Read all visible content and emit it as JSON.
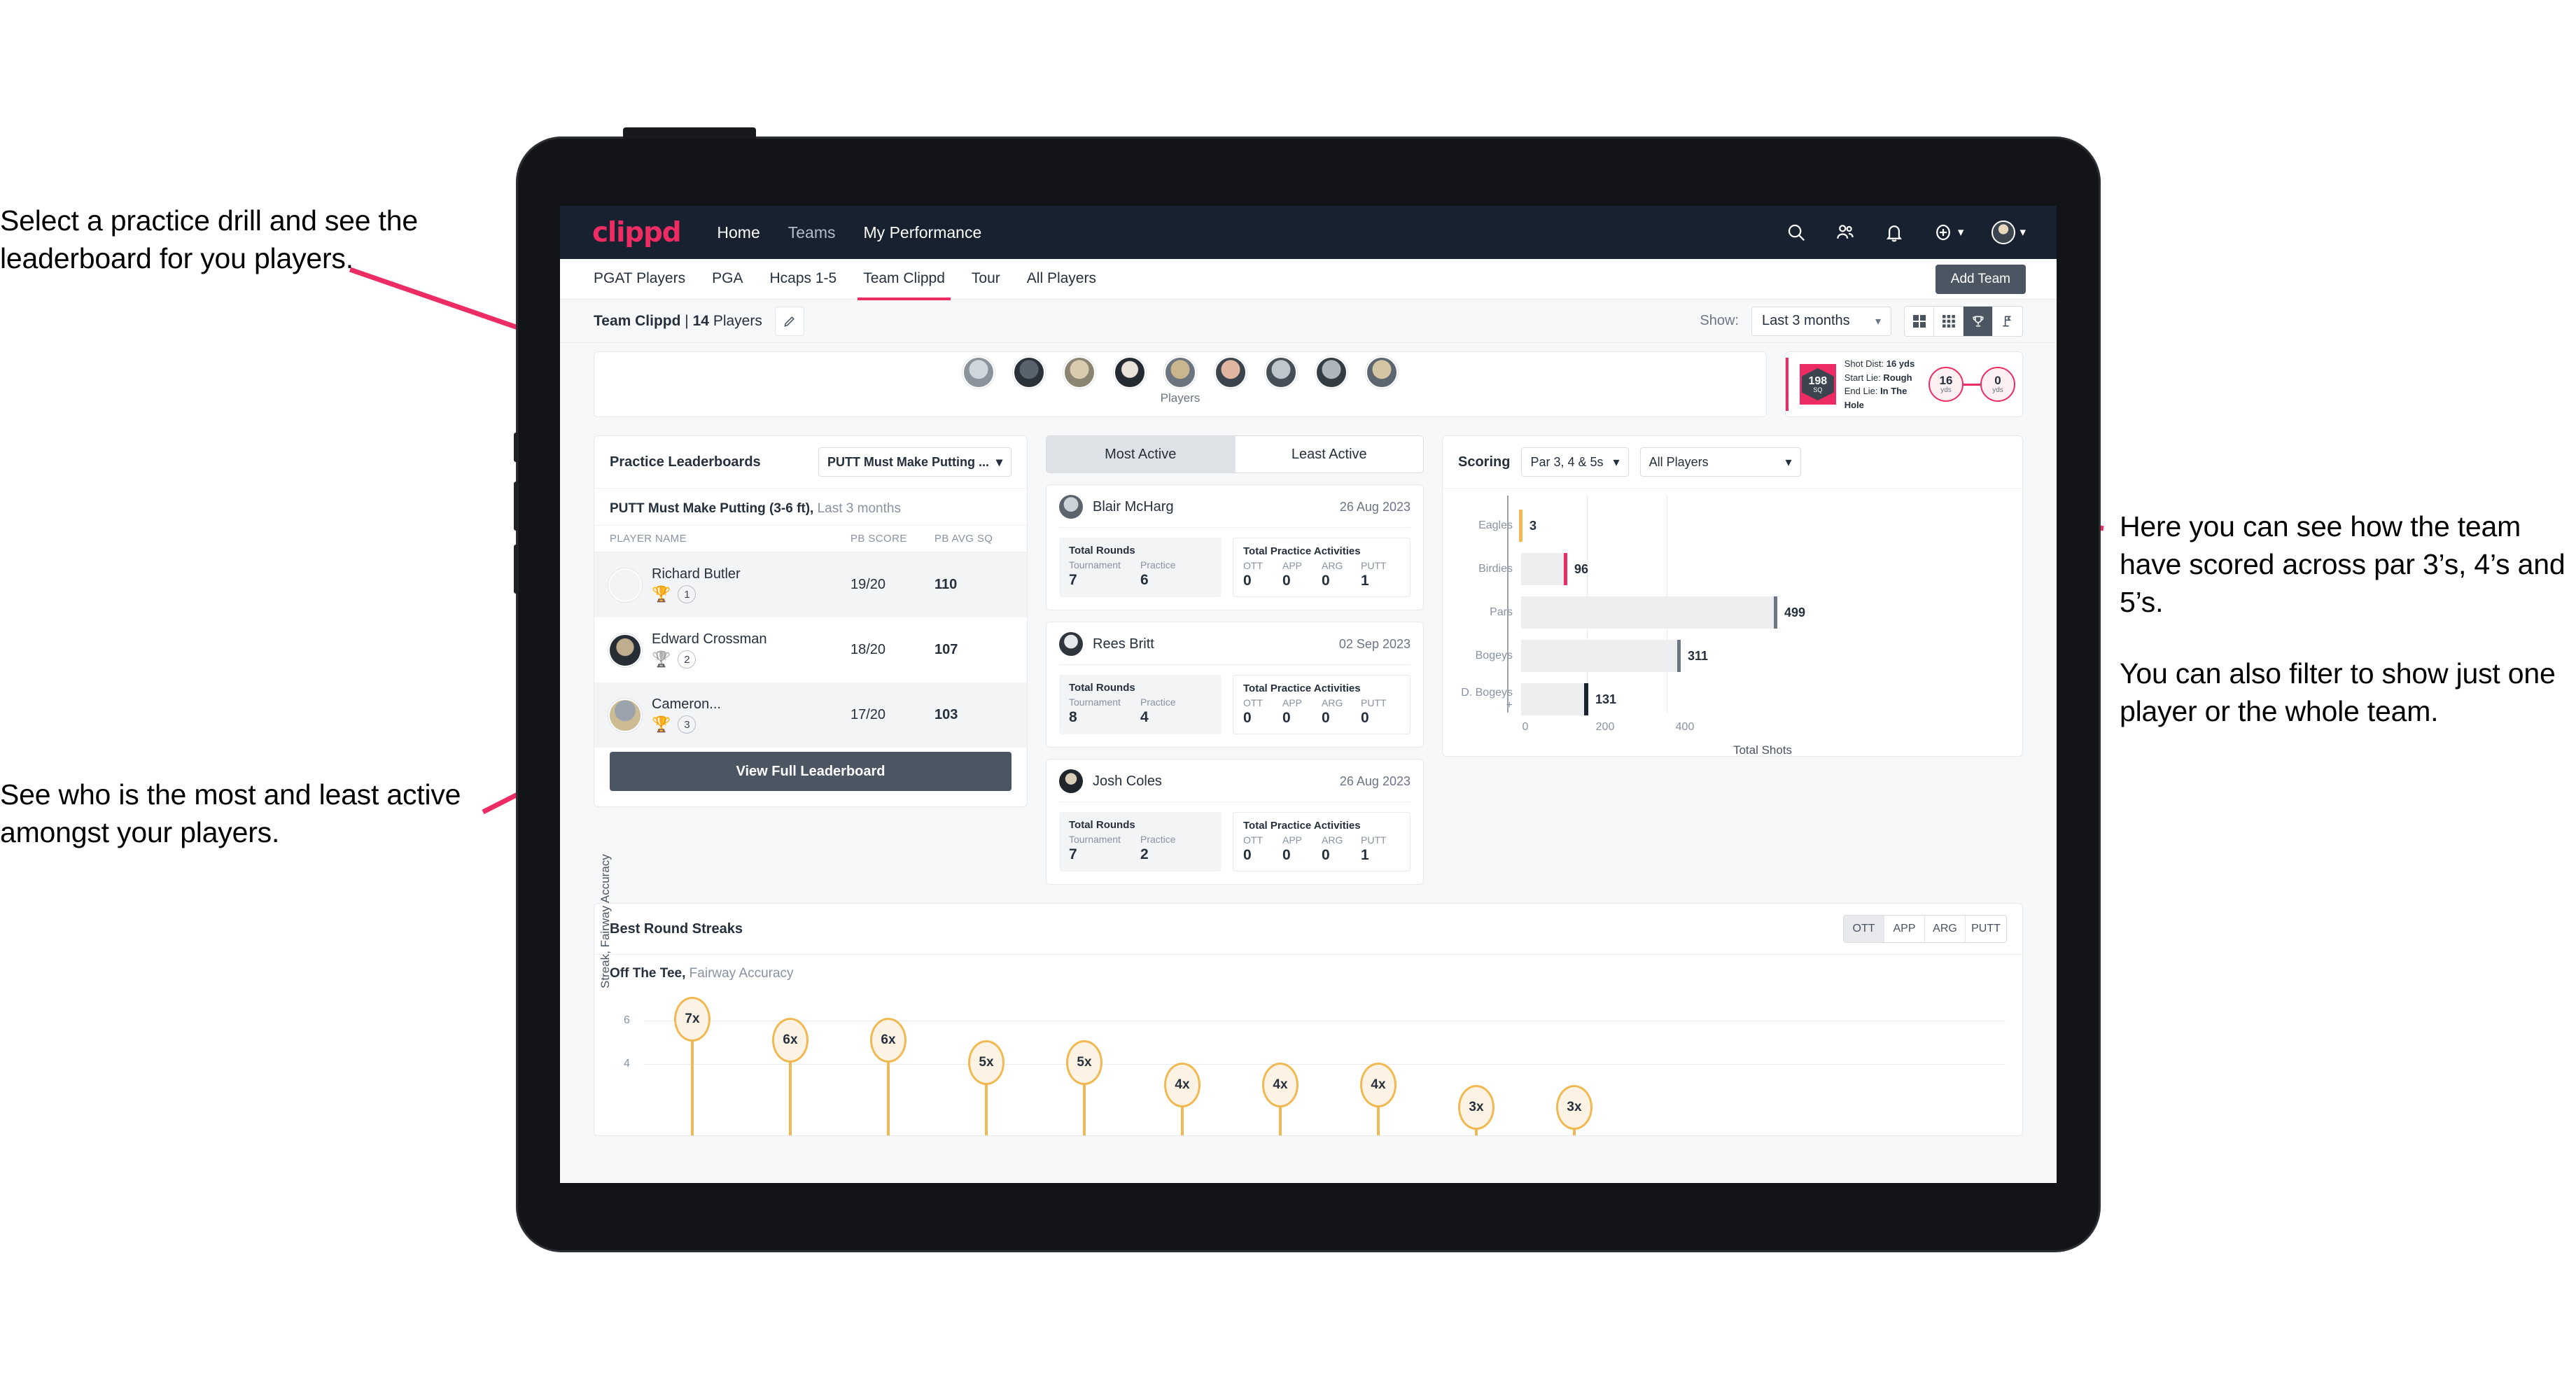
{
  "annotations": {
    "top_left": "Select a practice drill and see the leaderboard for you players.",
    "bottom_left": "See who is the most and least active amongst your players.",
    "right_1": "Here you can see how the team have scored across par 3’s, 4’s and 5’s.",
    "right_2": "You can also filter to show just one player or the whole team."
  },
  "topnav": {
    "brand": "clippd",
    "links": [
      {
        "label": "Home",
        "dim": false
      },
      {
        "label": "Teams",
        "dim": true
      },
      {
        "label": "My Performance",
        "dim": false
      }
    ],
    "icons": [
      "search-icon",
      "people-icon",
      "bell-icon",
      "plus-circle-icon",
      "avatar"
    ]
  },
  "tabs": {
    "items": [
      {
        "label": "PGAT Players",
        "active": false
      },
      {
        "label": "PGA",
        "active": false
      },
      {
        "label": "Hcaps 1-5",
        "active": false
      },
      {
        "label": "Team Clippd",
        "active": true
      },
      {
        "label": "Tour",
        "active": false
      },
      {
        "label": "All Players",
        "active": false
      }
    ],
    "add_team_label": "Add Team"
  },
  "subheader": {
    "team_name": "Team Clippd",
    "separator": "|",
    "player_count": "14",
    "players_word": "Players",
    "edit_icon": "pencil-icon",
    "show_label": "Show:",
    "range_value": "Last 3 months",
    "view_buttons": [
      "grid-large-icon",
      "grid-small-icon",
      "trophy-icon",
      "flag-icon"
    ]
  },
  "players_strip": {
    "caption": "Players",
    "avatar_count": 9
  },
  "shot_card": {
    "sq_value": "198",
    "sq_label": "SQ",
    "lines": [
      {
        "label": "Shot Dist:",
        "value": "16 yds"
      },
      {
        "label": "Start Lie:",
        "value": "Rough"
      },
      {
        "label": "End Lie:",
        "value": "In The Hole"
      }
    ],
    "start_dist": "16",
    "start_unit": "yds",
    "end_dist": "0",
    "end_unit": "yds"
  },
  "leaderboard": {
    "title": "Practice Leaderboards",
    "drill_select": "PUTT Must Make Putting ...",
    "subtitle_bold": "PUTT Must Make Putting (3-6 ft),",
    "subtitle_rest": "Last 3 months",
    "columns": [
      "PLAYER NAME",
      "PB SCORE",
      "PB AVG SQ"
    ],
    "rows": [
      {
        "name": "Richard Butler",
        "rank": "1",
        "trophy": "gold",
        "pb_score": "19/20",
        "pb_avg_sq": "110"
      },
      {
        "name": "Edward Crossman",
        "rank": "2",
        "trophy": "silver",
        "pb_score": "18/20",
        "pb_avg_sq": "107"
      },
      {
        "name": "Cameron...",
        "rank": "3",
        "trophy": "bronze",
        "pb_score": "17/20",
        "pb_avg_sq": "103"
      }
    ],
    "button_label": "View Full Leaderboard"
  },
  "activity": {
    "tabs": [
      {
        "label": "Most Active",
        "active": true
      },
      {
        "label": "Least Active",
        "active": false
      }
    ],
    "rounds_heading": "Total Rounds",
    "rounds_cols": [
      "Tournament",
      "Practice"
    ],
    "practice_heading": "Total Practice Activities",
    "practice_cols": [
      "OTT",
      "APP",
      "ARG",
      "PUTT"
    ],
    "items": [
      {
        "name": "Blair McHarg",
        "date": "26 Aug 2023",
        "tournament": "7",
        "practice": "6",
        "ott": "0",
        "app": "0",
        "arg": "0",
        "putt": "1"
      },
      {
        "name": "Rees Britt",
        "date": "02 Sep 2023",
        "tournament": "8",
        "practice": "4",
        "ott": "0",
        "app": "0",
        "arg": "0",
        "putt": "0"
      },
      {
        "name": "Josh Coles",
        "date": "26 Aug 2023",
        "tournament": "7",
        "practice": "2",
        "ott": "0",
        "app": "0",
        "arg": "0",
        "putt": "1"
      }
    ]
  },
  "scoring": {
    "title": "Scoring",
    "par_filter": "Par 3, 4 & 5s",
    "player_filter": "All Players"
  },
  "streaks": {
    "title": "Best Round Streaks",
    "segments": [
      {
        "label": "OTT",
        "active": true
      },
      {
        "label": "APP",
        "active": false
      },
      {
        "label": "ARG",
        "active": false
      },
      {
        "label": "PUTT",
        "active": false
      }
    ],
    "sub_bold": "Off The Tee,",
    "sub_rest": "Fairway Accuracy"
  },
  "chart_data": [
    {
      "type": "bar",
      "orientation": "horizontal",
      "title": "Scoring",
      "categories": [
        "Eagles",
        "Birdies",
        "Pars",
        "Bogeys",
        "D. Bogeys +"
      ],
      "values": [
        3,
        96,
        499,
        311,
        131
      ],
      "cap_colors": [
        "#f0b951",
        "#ec2c62",
        "#6b7583",
        "#6b7583",
        "#1b2330"
      ],
      "xlabel": "Total Shots",
      "ylabel": "",
      "xlim": [
        0,
        520
      ],
      "xticks": [
        0,
        200,
        400
      ],
      "grid": true,
      "legend": false
    },
    {
      "type": "bar",
      "orientation": "vertical",
      "subtype": "lollipop",
      "title": "Best Round Streaks — Off The Tee, Fairway Accuracy",
      "categories": [
        "",
        "",
        "",
        "",
        "",
        "",
        "",
        "",
        "",
        "",
        ""
      ],
      "values": [
        7,
        6,
        6,
        5,
        5,
        4,
        4,
        4,
        3,
        3
      ],
      "value_labels": [
        "7x",
        "6x",
        "6x",
        "5x",
        "5x",
        "4x",
        "4x",
        "4x",
        "3x",
        "3x"
      ],
      "ylabel": "Streak, Fairway Accuracy",
      "yticks": [
        4,
        6
      ],
      "ylim": [
        0,
        8
      ],
      "grid": true,
      "legend": false,
      "accent": "#f0b951"
    }
  ],
  "colors": {
    "brand_pink": "#ec2c62",
    "nav_dark": "#17212f",
    "slate": "#4c5663",
    "gold": "#f0b951",
    "page_bg": "#f7f8f9"
  }
}
